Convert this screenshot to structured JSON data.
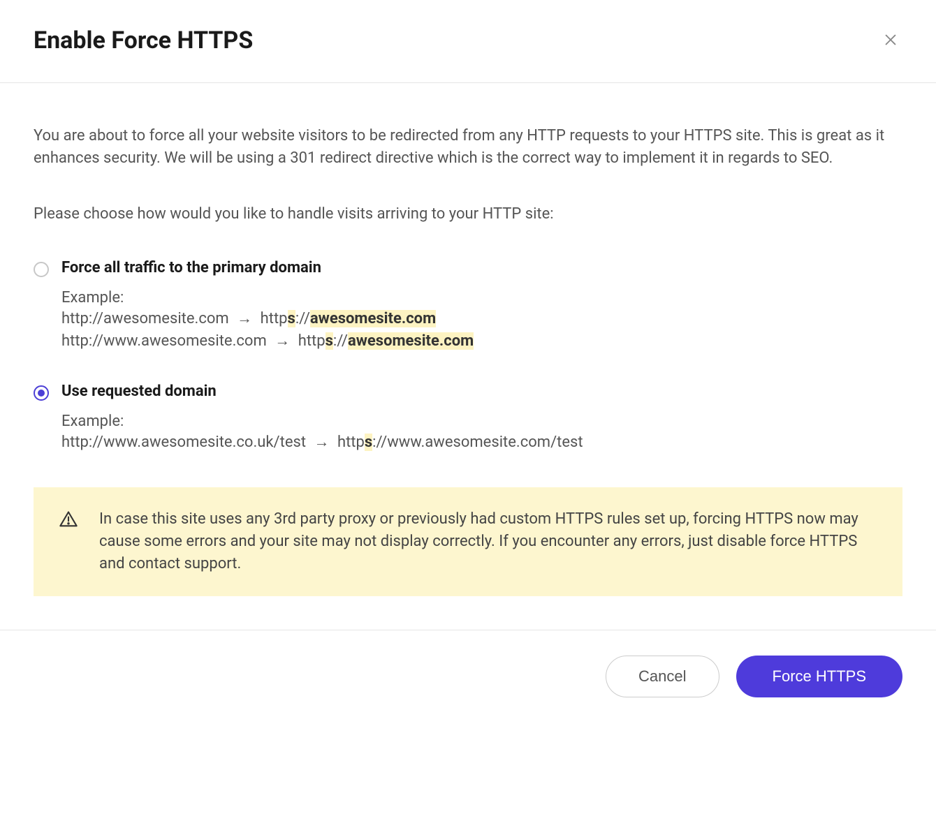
{
  "header": {
    "title": "Enable Force HTTPS"
  },
  "intro": "You are about to force all your website visitors to be redirected from any HTTP requests to your HTTPS site. This is great as it enhances security. We will be using a 301 redirect directive which is the correct way to implement it in regards to SEO.",
  "choose_prompt": "Please choose how would you like to handle visits arriving to your HTTP site:",
  "options": {
    "primary": {
      "label": "Force all traffic to the primary domain",
      "example_label": "Example:",
      "ex1_from": "http://awesomesite.com",
      "ex1_to_prefix": "http",
      "ex1_to_s": "s",
      "ex1_to_sep": "://",
      "ex1_to_domain": "awesomesite.com",
      "ex2_from": "http://www.awesomesite.com",
      "ex2_to_prefix": "http",
      "ex2_to_s": "s",
      "ex2_to_sep": "://",
      "ex2_to_domain": "awesomesite.com",
      "selected": false
    },
    "requested": {
      "label": "Use requested domain",
      "example_label": "Example:",
      "ex_from": "http://www.awesomesite.co.uk/test",
      "ex_to_prefix": "http",
      "ex_to_s": "s",
      "ex_to_rest": "://www.awesomesite.com/test",
      "selected": true
    }
  },
  "arrow": "→",
  "warning": "In case this site uses any 3rd party proxy or previously had custom HTTPS rules set up, forcing HTTPS now may cause some errors and your site may not display correctly. If you encounter any errors, just disable force HTTPS and contact support.",
  "footer": {
    "cancel": "Cancel",
    "confirm": "Force HTTPS"
  }
}
